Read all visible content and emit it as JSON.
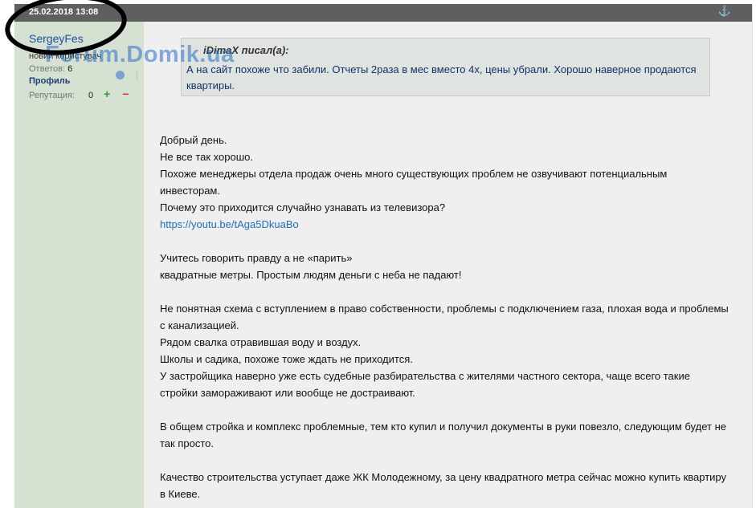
{
  "post": {
    "date": "25.02.2018 13:08",
    "anchor_icon": "anchor-icon"
  },
  "user": {
    "name": "SergeyFes",
    "role": "новий користувач",
    "posts_label": "Ответов:",
    "posts_count": "6",
    "profile_label": "Профиль",
    "reputation_label": "Репутация:",
    "reputation_value": "0",
    "rep_plus": "+",
    "rep_minus": "−"
  },
  "watermark": "Forum.Domik.ua",
  "quote": {
    "author": "iDimaX писал(а):",
    "text": "А на сайт похоже что забили. Отчеты 2раза в мес вместо 4х, цены убрали. Хорошо наверное продаются квартиры."
  },
  "body": {
    "lines": [
      "Добрый день.",
      "Не все так хорошо.",
      "Похоже менеджеры отдела продаж очень много существующих проблем не озвучивают потенциальным",
      "инвесторам.",
      "Почему это приходится случайно узнавать из телевизора?",
      "https://youtu.be/tAga5DkuaBo",
      "",
      "Учитесь говорить правду а не «парить»",
      "квадратные метры. Простым людям деньги с неба не падают!",
      "",
      "Не понятная схема с вступлением в право собственности, проблемы с подключением газа, плохая вода и проблемы",
      "с канализацией.",
      "Рядом свалка отравившая воду и воздух.",
      "Школы и садика, похоже тоже ждать не приходится.",
      "У застройщика наверно уже есть судебные разбирательства с жителями частного сектора, чаще всего такие",
      "стройки замораживают или вообще не достраивают.",
      "",
      "В общем стройка и комплекс проблемные, тем кто купил и получил документы в руки повезло, следующим будет не",
      "так просто.",
      "",
      "Качество строительства уступает даже ЖК Молодежному, за цену квадратного метра сейчас можно купить квартиру",
      "в Киеве."
    ]
  },
  "colors": {
    "header": "#5f5f5f",
    "sidebar": "#d6e2d1",
    "content": "#efefef",
    "link": "#1f6fc4"
  }
}
